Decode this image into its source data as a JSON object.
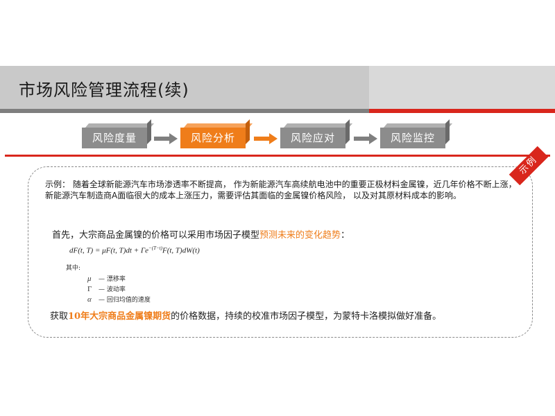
{
  "header": {
    "title": "市场风险管理流程(续)"
  },
  "flow": {
    "steps": [
      {
        "label": "风险度量",
        "state": "inactive"
      },
      {
        "label": "风险分析",
        "state": "active"
      },
      {
        "label": "风险应对",
        "state": "inactive"
      },
      {
        "label": "风险监控",
        "state": "inactive"
      }
    ]
  },
  "example": {
    "tag": "示例",
    "intro": "示例： 随着全球新能源汽车市场渗透率不断提高， 作为新能源汽车高续航电池中的重要正极材料金属镍，近几年价格不断上涨，新能源汽车制造商A面临很大的成本上涨压力，需要评估其面临的金属镍价格风险， 以及对其原材料成本的影响。",
    "first_prefix": "首先，大宗商品金属镍的价格可以采用市场因子模型",
    "first_highlight": "预测未来的变化趋势",
    "first_suffix": "：",
    "formula": {
      "lhs": "dF(t, T) = μF(t, T)dt + Γe",
      "exponent": "−(T−t)",
      "rhs": "F(t, T)dW(t)"
    },
    "where": "其中:",
    "definitions": [
      {
        "symbol": "μ",
        "text": "— 漂移率"
      },
      {
        "symbol": "Γ",
        "text": "— 波动率"
      },
      {
        "symbol": "α",
        "text": "— 回归均值的速度"
      }
    ],
    "last_prefix": "获取",
    "last_highlight": "10年大宗商品金属镍期货",
    "last_suffix": "的价格数据，持续的校准市场因子模型，为蒙特卡洛模拟做好准备。"
  },
  "colors": {
    "accent_red": "#d9261c",
    "accent_orange": "#ef7d1a",
    "step_gray": "#8c8c8c"
  }
}
